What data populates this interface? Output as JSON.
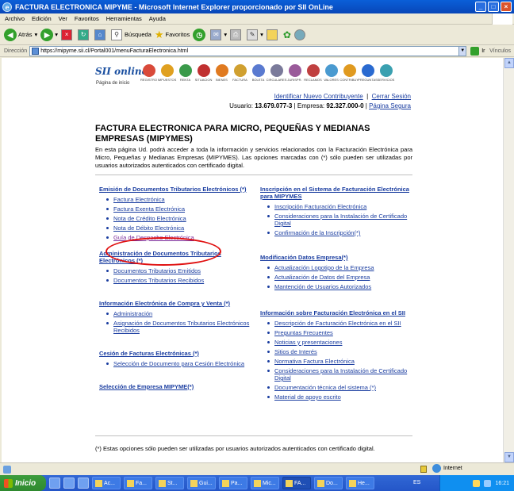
{
  "window": {
    "title": "FACTURA ELECTRONICA MIPYME - Microsoft Internet Explorer proporcionado por SII OnLine"
  },
  "menu": [
    "Archivo",
    "Edición",
    "Ver",
    "Favoritos",
    "Herramientas",
    "Ayuda"
  ],
  "toolbar": {
    "back": "Atrás",
    "search": "Búsqueda",
    "favorites": "Favoritos"
  },
  "address": {
    "label": "Dirección",
    "url": "https://mipyme.sii.cl/Portal001/menuFacturaElectronica.html",
    "go": "Ir",
    "links": "Vínculos"
  },
  "site": {
    "logo": "SII online",
    "logo_tag": "Página de inicio",
    "nav_icons": [
      {
        "label": "REGISTRO",
        "color": "#d94a3a"
      },
      {
        "label": "IMPUESTOS",
        "color": "#e0a020"
      },
      {
        "label": "RENTA",
        "color": "#3a9a4a"
      },
      {
        "label": "SITUACION",
        "color": "#c03030"
      },
      {
        "label": "BIENES",
        "color": "#e07a20"
      },
      {
        "label": "FACTURA",
        "color": "#d0a030"
      },
      {
        "label": "BOLETA",
        "color": "#5a7ad0"
      },
      {
        "label": "CIRCULARES",
        "color": "#7a7a9a"
      },
      {
        "label": "JURISPR.",
        "color": "#9a5a9a"
      },
      {
        "label": "RECLAMOS",
        "color": "#c04040"
      },
      {
        "label": "VALORES",
        "color": "#4a9ad0"
      },
      {
        "label": "CONTRIBUY.",
        "color": "#e09a20"
      },
      {
        "label": "PREGUNTAS",
        "color": "#2a6ad0"
      },
      {
        "label": "SERVICIOS",
        "color": "#3aa0b0"
      }
    ],
    "identify_link": "Identificar Nuevo Contribuyente",
    "logout_link": "Cerrar Sesión",
    "user_label": "Usuario:",
    "user_value": "13.679.077-3",
    "company_label": "| Empresa:",
    "company_value": "92.327.000-0",
    "secure_link": "Página Segura"
  },
  "page": {
    "title": "FACTURA ELECTRONICA PARA MICRO, PEQUEÑAS Y MEDIANAS EMPRESAS (MIPYMES)",
    "intro": "En esta página Ud. podrá acceder a toda la información y servicios relacionados con la Facturación Electrónica para Micro, Pequeñas y Medianas Empresas (MIPYMES). Las opciones marcadas con (*) sólo pueden ser utilizadas por usuarios autorizados autenticados con certificado digital.",
    "left": [
      {
        "title": "Emisión de Documentos Tributarios Electrónicos (*)",
        "items": [
          "Factura Electrónica",
          "Factura Exenta Electrónica",
          "Nota de Crédito Electrónica",
          "Nota de Débito Electrónica",
          "Guía de Despacho Electrónica"
        ]
      },
      {
        "title": "Administración de Documentos Tributarios Electrónicos (*)",
        "items": [
          "Documentos Tributarios Emitidos",
          "Documentos Tributarios Recibidos"
        ]
      },
      {
        "title": "Información Electrónica de Compra y Venta (*)",
        "items": [
          "Administración",
          "Asignación de Documentos Tributarios Electrónicos Recibidos"
        ]
      },
      {
        "title": "Cesión de Facturas Electrónicas (*)",
        "items": [
          "Selección de Documento para Cesión Electrónica"
        ]
      },
      {
        "title": "Selección de Empresa MIPYME(*)",
        "items": []
      }
    ],
    "right": [
      {
        "title": "Inscripción en el Sistema de Facturación Electrónica para MIPYMES",
        "items": [
          "Inscripción Facturación Electrónica",
          "Consideraciones para la Instalación de Certificado Digital",
          "Confirmación de la Inscripción(*)"
        ]
      },
      {
        "title": "Modificación Datos Empresa(*)",
        "items": [
          "Actualización Logotipo de la Empresa",
          "Actualización de Datos del Empresa",
          "Mantención de Usuarios Autorizados"
        ]
      },
      {
        "title": "Información sobre Facturación Electrónica en el SII",
        "items": [
          "Descripción de Facturación Electrónica en el SII",
          "Preguntas Frecuentes",
          "Noticias y presentaciones",
          "Sitios de Interés",
          "Normativa Factura Electrónica",
          "Consideraciones para la Instalación de Certificado Digital",
          "Documentación técnica del sistema (*)",
          "Material de apoyo escrito"
        ]
      }
    ],
    "footnote": "(*) Estas opciones sólo pueden ser utilizadas por usuarios autorizados autenticados con certificado digital."
  },
  "status": {
    "zone": "Internet"
  },
  "taskbar": {
    "start": "Inicio",
    "tasks": [
      "Ac...",
      "Fa...",
      "St...",
      "Gui...",
      "Pa...",
      "Mic...",
      "FA...",
      "Do...",
      "He..."
    ],
    "lang": "ES",
    "clock": "16:21"
  }
}
